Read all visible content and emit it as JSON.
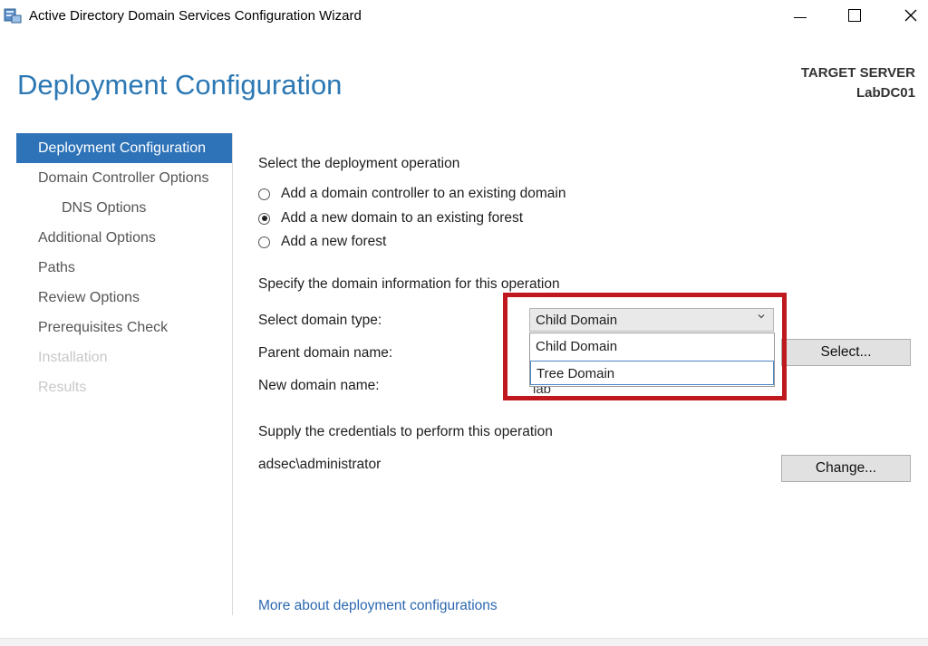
{
  "window": {
    "title": "Active Directory Domain Services Configuration Wizard",
    "icon": "server-wizard-icon"
  },
  "header": {
    "page_title": "Deployment Configuration",
    "target_label": "TARGET SERVER",
    "target_name": "LabDC01"
  },
  "sidebar": {
    "items": [
      {
        "label": "Deployment Configuration",
        "state": "active"
      },
      {
        "label": "Domain Controller Options",
        "state": "normal"
      },
      {
        "label": "DNS Options",
        "state": "normal"
      },
      {
        "label": "Additional Options",
        "state": "normal"
      },
      {
        "label": "Paths",
        "state": "normal"
      },
      {
        "label": "Review Options",
        "state": "normal"
      },
      {
        "label": "Prerequisites Check",
        "state": "normal"
      },
      {
        "label": "Installation",
        "state": "disabled"
      },
      {
        "label": "Results",
        "state": "disabled"
      }
    ]
  },
  "main": {
    "operation_heading": "Select the deployment operation",
    "operations": [
      {
        "label": "Add a domain controller to an existing domain",
        "checked": false
      },
      {
        "label": "Add a new domain to an existing forest",
        "checked": true
      },
      {
        "label": "Add a new forest",
        "checked": false
      }
    ],
    "domain_info_heading": "Specify the domain information for this operation",
    "domain_type_label": "Select domain type:",
    "domain_type_value": "Child Domain",
    "domain_type_options": [
      "Child Domain",
      "Tree Domain"
    ],
    "parent_domain_label": "Parent domain name:",
    "select_button": "Select...",
    "new_domain_label": "New domain name:",
    "new_domain_value": "lab",
    "credentials_heading": "Supply the credentials to perform this operation",
    "credentials_user": "adsec\\administrator",
    "change_button": "Change...",
    "more_link": "More about deployment configurations"
  },
  "colors": {
    "accent": "#2e73b8",
    "title": "#2c78b4",
    "highlight": "#c0181f",
    "link": "#2c68b0"
  }
}
